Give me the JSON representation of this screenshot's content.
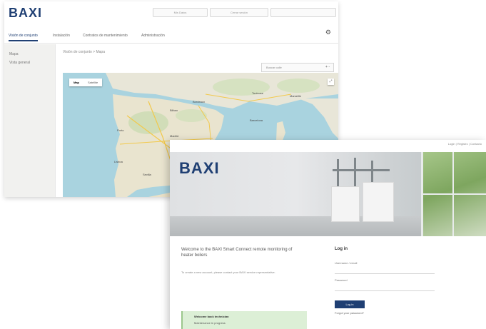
{
  "back_window": {
    "logo": "BAXI",
    "top_fields": [
      "Mis Datos",
      "Cerrar sesión"
    ],
    "tabs": [
      {
        "label": "Visión de conjunto"
      },
      {
        "label": "Instalación"
      },
      {
        "label": "Contratos de mantenimiento"
      },
      {
        "label": "Administración"
      }
    ],
    "sidebar": [
      {
        "label": "Mapa"
      },
      {
        "label": "Vista general"
      }
    ],
    "breadcrumb": "Visión de conjunto  >  Mapa",
    "select_value": "Buscar calle",
    "zoom": "+ -",
    "map": {
      "mode_buttons": [
        "Map",
        "Satellite"
      ],
      "cities": [
        "Bordeaux",
        "Toulouse",
        "Marseille",
        "Barcelona",
        "Madrid",
        "Valencia",
        "Porto",
        "Lisboa",
        "Sevilla",
        "Bilbao"
      ]
    },
    "colors": {
      "brand": "#1f3f73",
      "sea": "#a9d3df",
      "land": "#e8e3d3"
    }
  },
  "front_window": {
    "top_link": "Login | Registro | Contacto",
    "logo": "BAXI",
    "welcome_title": "Welcome to the BAXI Smart Connect remote monitoring of heater boilers",
    "welcome_body": "To create a new account, please contact your BAXI service representative.",
    "login": {
      "title": "Log in",
      "username_label": "Username / email",
      "password_label": "Password",
      "button": "Log in",
      "forgot": "Forgot your password?"
    },
    "notice": {
      "line1": "Welcome back technician",
      "line2": "Maintenance in progress"
    }
  }
}
